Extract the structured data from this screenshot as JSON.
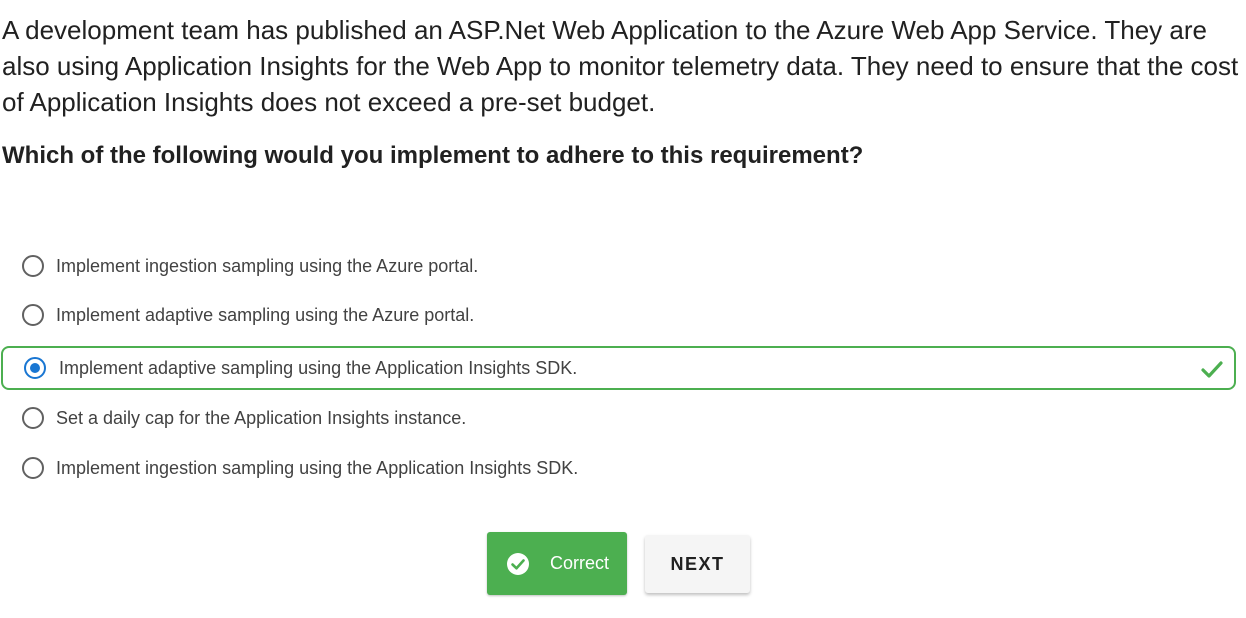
{
  "question": {
    "text": "A development team has published an ASP.Net Web Application to the Azure Web App Service. They are also using Application Insights for the Web App to monitor telemetry data. They need to ensure that the cost of Application Insights does not exceed a pre-set budget.",
    "prompt": "Which of the following would you implement to adhere to this requirement?"
  },
  "options": [
    {
      "label": "Implement ingestion sampling using the Azure portal.",
      "selected": false
    },
    {
      "label": "Implement adaptive sampling using the Azure portal.",
      "selected": false
    },
    {
      "label": "Implement adaptive sampling using the Application Insights SDK.",
      "selected": true,
      "marked_correct": true
    },
    {
      "label": "Set a daily cap for the Application Insights instance.",
      "selected": false
    },
    {
      "label": "Implement ingestion sampling using the Application Insights SDK.",
      "selected": false
    }
  ],
  "actions": {
    "correct_label": "Correct",
    "next_label": "NEXT"
  },
  "colors": {
    "correct_green": "#4caf50",
    "radio_selected_blue": "#1976d2",
    "next_bg": "#f5f5f5"
  },
  "icons": {
    "correct_check": "check-icon",
    "button_check": "circle-check-icon"
  }
}
